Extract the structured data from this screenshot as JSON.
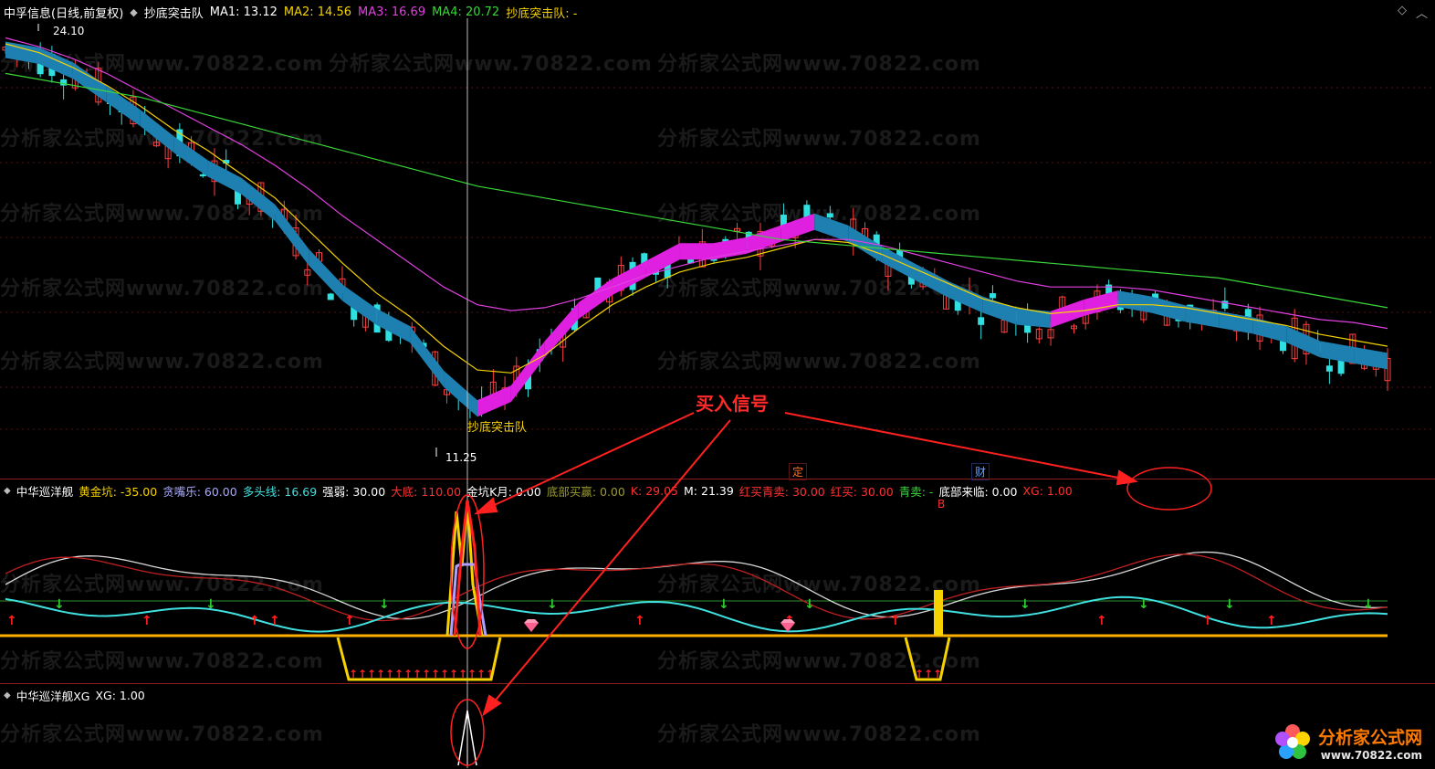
{
  "main": {
    "title": "中孚信息(日线,前复权)",
    "indicator": "抄底突击队",
    "ma": [
      {
        "label": "MA1: 13.12",
        "color": "#ffffff"
      },
      {
        "label": "MA2: 14.56",
        "color": "#f5d200"
      },
      {
        "label": "MA3: 16.69",
        "color": "#e040e0"
      },
      {
        "label": "MA4: 20.72",
        "color": "#39d639"
      }
    ],
    "signal_label": "抄底突击队: -",
    "high_label": "24.10",
    "low_label": "11.25",
    "marker_label": "抄底突击队"
  },
  "pane2": {
    "title": "中华巡洋舰",
    "fields": [
      {
        "label": "黄金坑: -35.00",
        "color": "#f5d200"
      },
      {
        "label": "贪嘴乐: 60.00",
        "color": "#a8a8ff"
      },
      {
        "label": "多头线: 16.69",
        "color": "#40e0e0"
      },
      {
        "label": "强弱: 30.00",
        "color": "#ffffff"
      },
      {
        "label": "大底: 110.00",
        "color": "#ff3030"
      },
      {
        "label": "金坑K月: 0.00",
        "color": "#ffffff"
      },
      {
        "label": "底部买赢: 0.00",
        "color": "#9a9a30"
      },
      {
        "label": "K: 29.05",
        "color": "#ff3030"
      },
      {
        "label": "M: 21.39",
        "color": "#ffffff"
      },
      {
        "label": "红买青卖: 30.00",
        "color": "#ff3030"
      },
      {
        "label": "红买: 30.00",
        "color": "#ff3030"
      },
      {
        "label": "青卖: -",
        "color": "#39d639"
      },
      {
        "label": "底部来临: 0.00",
        "color": "#ffffff"
      },
      {
        "label": "XG: 1.00",
        "color": "#ff3030"
      }
    ],
    "tag_ding": "定",
    "tag_cai": "财",
    "tag_b": "B"
  },
  "pane3": {
    "title": "中华巡洋舰XG",
    "xg": "XG: 1.00"
  },
  "annotation": "买入信号",
  "watermark": "分析家公式网www.70822.com",
  "logo": {
    "name": "分析家公式网",
    "url": "www.70822.com"
  },
  "chart_data": {
    "type": "line",
    "title": "中孚信息(日线,前复权)",
    "series": [
      {
        "name": "MA1",
        "values": [
          23.6,
          23.4,
          22.9,
          22.1,
          21.3,
          20.4,
          19.6,
          19.0,
          18.1,
          16.6,
          15.4,
          14.6,
          14.0,
          12.5,
          11.5,
          12.0,
          13.5,
          14.8,
          15.6,
          16.2,
          16.8,
          16.8,
          17.0,
          17.4,
          17.8,
          17.4,
          16.7,
          16.1,
          15.5,
          15.0,
          14.6,
          14.5,
          14.9,
          15.2,
          15.0,
          14.7,
          14.5,
          14.3,
          14.0,
          13.5,
          13.3,
          13.1
        ]
      },
      {
        "name": "MA2",
        "values": [
          23.8,
          23.5,
          23.0,
          22.4,
          21.7,
          20.9,
          20.2,
          19.4,
          18.6,
          17.5,
          16.4,
          15.4,
          14.6,
          13.6,
          12.8,
          12.7,
          13.3,
          14.2,
          15.0,
          15.6,
          16.1,
          16.4,
          16.6,
          16.9,
          17.2,
          17.1,
          16.7,
          16.2,
          15.7,
          15.2,
          14.9,
          14.7,
          14.8,
          15.0,
          15.0,
          14.9,
          14.7,
          14.5,
          14.3,
          14.0,
          13.8,
          13.6
        ]
      },
      {
        "name": "MA3",
        "values": [
          24.0,
          23.7,
          23.3,
          22.8,
          22.2,
          21.6,
          21.0,
          20.4,
          19.7,
          18.9,
          18.0,
          17.2,
          16.4,
          15.6,
          15.0,
          14.8,
          14.9,
          15.2,
          15.6,
          16.0,
          16.3,
          16.6,
          16.8,
          17.0,
          17.2,
          17.2,
          17.0,
          16.7,
          16.4,
          16.1,
          15.8,
          15.6,
          15.6,
          15.6,
          15.5,
          15.3,
          15.1,
          14.9,
          14.7,
          14.5,
          14.4,
          14.2
        ]
      },
      {
        "name": "MA4",
        "values": [
          22.8,
          22.6,
          22.4,
          22.2,
          22.0,
          21.7,
          21.4,
          21.1,
          20.8,
          20.5,
          20.2,
          19.9,
          19.6,
          19.3,
          19.0,
          18.8,
          18.6,
          18.4,
          18.2,
          18.0,
          17.8,
          17.6,
          17.4,
          17.2,
          17.1,
          17.0,
          16.9,
          16.8,
          16.7,
          16.6,
          16.5,
          16.4,
          16.3,
          16.2,
          16.1,
          16.0,
          15.9,
          15.7,
          15.5,
          15.3,
          15.1,
          14.9
        ]
      }
    ],
    "ylim": [
      10.8,
      24.6
    ],
    "annotations": [
      "24.10",
      "11.25",
      "抄底突击队"
    ],
    "grid": true
  }
}
